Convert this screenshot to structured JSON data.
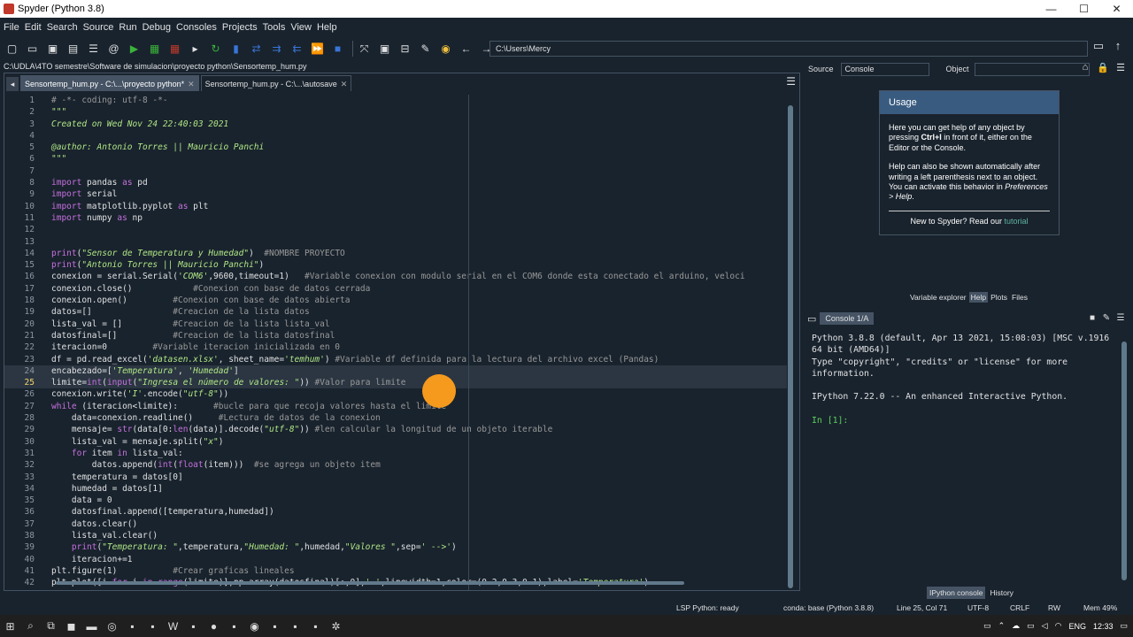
{
  "window": {
    "title": "Spyder (Python 3.8)",
    "minimize": "—",
    "maximize": "☐",
    "close": "✕"
  },
  "menu": [
    "File",
    "Edit",
    "Search",
    "Source",
    "Run",
    "Debug",
    "Consoles",
    "Projects",
    "Tools",
    "View",
    "Help"
  ],
  "toolbar": {
    "path": "C:\\Users\\Mercy"
  },
  "file_path": "C:\\UDLA\\4TO semestre\\Software de simulacion\\proyecto python\\Sensortemp_hum.py",
  "editor": {
    "tabs": [
      {
        "label": "Sensortemp_hum.py - C:\\...\\proyecto python*",
        "close": "✕"
      },
      {
        "label": "Sensortemp_hum.py - C:\\...\\autosave",
        "close": "✕"
      }
    ],
    "current_line": "25",
    "lines": [
      {
        "n": "1",
        "t": "# -*- coding: utf-8 -*-"
      },
      {
        "n": "2",
        "t": "\"\"\""
      },
      {
        "n": "3",
        "t": "Created on Wed Nov 24 22:40:03 2021"
      },
      {
        "n": "4",
        "t": ""
      },
      {
        "n": "5",
        "t": "@author: Antonio Torres || Mauricio Panchi"
      },
      {
        "n": "6",
        "t": "\"\"\""
      },
      {
        "n": "7",
        "t": ""
      },
      {
        "n": "8",
        "t": "import pandas as pd"
      },
      {
        "n": "9",
        "t": "import serial"
      },
      {
        "n": "10",
        "t": "import matplotlib.pyplot as plt"
      },
      {
        "n": "11",
        "t": "import numpy as np"
      },
      {
        "n": "12",
        "t": ""
      },
      {
        "n": "13",
        "t": ""
      },
      {
        "n": "14",
        "t": "print(\"Sensor de Temperatura y Humedad\")  #NOMBRE PROYECTO"
      },
      {
        "n": "15",
        "t": "print(\"Antonio Torres || Mauricio Panchi\")"
      },
      {
        "n": "16",
        "t": "conexion = serial.Serial('COM6',9600,timeout=1)   #Variable conexion con modulo serial en el COM6 donde esta conectado el arduino, veloci"
      },
      {
        "n": "17",
        "t": "conexion.close()            #Conexion con base de datos cerrada"
      },
      {
        "n": "18",
        "t": "conexion.open()         #Conexion con base de datos abierta"
      },
      {
        "n": "19",
        "t": "datos=[]                #Creacion de la lista datos"
      },
      {
        "n": "20",
        "t": "lista_val = []          #Creacion de la lista lista_val"
      },
      {
        "n": "21",
        "t": "datosfinal=[]           #Creacion de la lista datosfinal"
      },
      {
        "n": "22",
        "t": "iteracion=0         #Variable iteracion inicializada en 0"
      },
      {
        "n": "23",
        "t": "df = pd.read_excel('datasen.xlsx', sheet_name='temhum') #Variable df definida para la lectura del archivo excel (Pandas)"
      },
      {
        "n": "24",
        "t": "encabezado=['Temperatura', 'Humedad']"
      },
      {
        "n": "25",
        "t": "limite=int(input(\"Ingresa el número de valores: \")) #Valor para limite"
      },
      {
        "n": "26",
        "t": "conexion.write('I'.encode(\"utf-8\"))"
      },
      {
        "n": "27",
        "t": "while (iteracion<limite):       #bucle para que recoja valores hasta el limite"
      },
      {
        "n": "28",
        "t": "    data=conexion.readline()     #Lectura de datos de la conexion"
      },
      {
        "n": "29",
        "t": "    mensaje= str(data[0:len(data)].decode(\"utf-8\")) #len calcular la longitud de un objeto iterable"
      },
      {
        "n": "30",
        "t": "    lista_val = mensaje.split(\"x\")"
      },
      {
        "n": "31",
        "t": "    for item in lista_val:"
      },
      {
        "n": "32",
        "t": "        datos.append(int(float(item)))  #se agrega un objeto item"
      },
      {
        "n": "33",
        "t": "    temperatura = datos[0]"
      },
      {
        "n": "34",
        "t": "    humedad = datos[1]"
      },
      {
        "n": "35",
        "t": "    data = 0"
      },
      {
        "n": "36",
        "t": "    datosfinal.append([temperatura,humedad])"
      },
      {
        "n": "37",
        "t": "    datos.clear()"
      },
      {
        "n": "38",
        "t": "    lista_val.clear()"
      },
      {
        "n": "39",
        "t": "    print(\"Temperatura: \",temperatura,\"Humedad: \",humedad,\"Valores \",sep=' -->')"
      },
      {
        "n": "40",
        "t": "    iteracion+=1"
      },
      {
        "n": "41",
        "t": "plt.figure(1)           #Crear graficas lineales"
      },
      {
        "n": "42",
        "t": "plt.plot([i for i in range(limite)],np.array(datosfinal)[:,0],'-',linewidth=1,color=(0.2,0.3,0.1),label='Temperatura')"
      }
    ]
  },
  "help": {
    "source_label": "Source",
    "source_value": "Console",
    "object_label": "Object",
    "usage_title": "Usage",
    "p1_a": "Here you can get help of any object by pressing ",
    "p1_key": "Ctrl+I",
    "p1_b": " in front of it, either on the Editor or the Console.",
    "p2_a": "Help can also be shown automatically after writing a left parenthesis next to an object. You can activate this behavior in ",
    "p2_em": "Preferences > Help",
    "p2_b": ".",
    "new_a": "New to Spyder? Read our ",
    "new_link": "tutorial",
    "tabs": [
      "Variable explorer",
      "Help",
      "Plots",
      "Files"
    ]
  },
  "console": {
    "tab": "Console 1/A",
    "text": "Python 3.8.8 (default, Apr 13 2021, 15:08:03) [MSC v.1916\n64 bit (AMD64)]\nType \"copyright\", \"credits\" or \"license\" for more\ninformation.\n\nIPython 7.22.0 -- An enhanced Interactive Python.\n\n",
    "prompt": "In [1]:",
    "bottom_tabs": [
      "IPython console",
      "History"
    ]
  },
  "status": {
    "lsp": "LSP Python: ready",
    "conda": "conda: base (Python 3.8.8)",
    "position": "Line 25, Col 71",
    "encoding": "UTF-8",
    "eol": "CRLF",
    "rw": "RW",
    "mem": "Mem 49%"
  },
  "taskbar": {
    "lang": "ENG",
    "time": "12:33"
  }
}
